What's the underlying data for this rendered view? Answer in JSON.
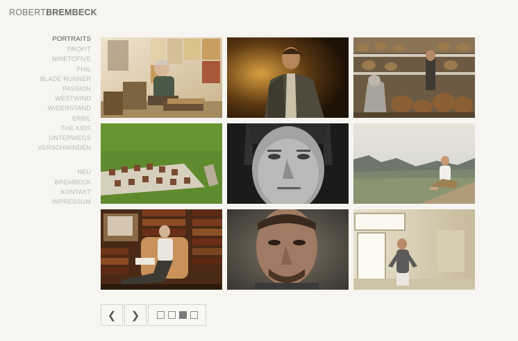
{
  "header": {
    "logo_first": "ROBERT",
    "logo_last": "BREMBECK"
  },
  "nav": {
    "primary": [
      "PORTRAITS",
      "PROFIT",
      "NINETOFIVE",
      "PHIL",
      "BLADE RUNNER",
      "PASSION",
      "WESTWIND",
      "WIDERSTAND",
      "ERBIL",
      "THE KIDS",
      "UNTERWEGS",
      "VERSCHWINDEN"
    ],
    "secondary": [
      "NEU",
      "BREMBECK",
      "KONTAKT",
      "IMPRESSUM"
    ],
    "active": "PORTRAITS"
  },
  "gallery": {
    "photos": [
      {
        "name": "photo-artist-studio"
      },
      {
        "name": "photo-man-dark-coat"
      },
      {
        "name": "photo-taxidermy-room"
      },
      {
        "name": "photo-chairs-on-lawn"
      },
      {
        "name": "photo-bw-face-closeup"
      },
      {
        "name": "photo-man-mountain-valley"
      },
      {
        "name": "photo-man-library-armchair"
      },
      {
        "name": "photo-man-closeup-portrait"
      },
      {
        "name": "photo-man-bright-room"
      }
    ]
  },
  "pager": {
    "prev_icon": "chevron-left-icon",
    "next_icon": "chevron-right-icon",
    "prev_glyph": "❮",
    "next_glyph": "❯",
    "pages": 4,
    "current_page": 3
  },
  "colors": {
    "background": "#f6f5f1",
    "nav_inactive": "#b9b9b9",
    "nav_active": "#555555"
  }
}
